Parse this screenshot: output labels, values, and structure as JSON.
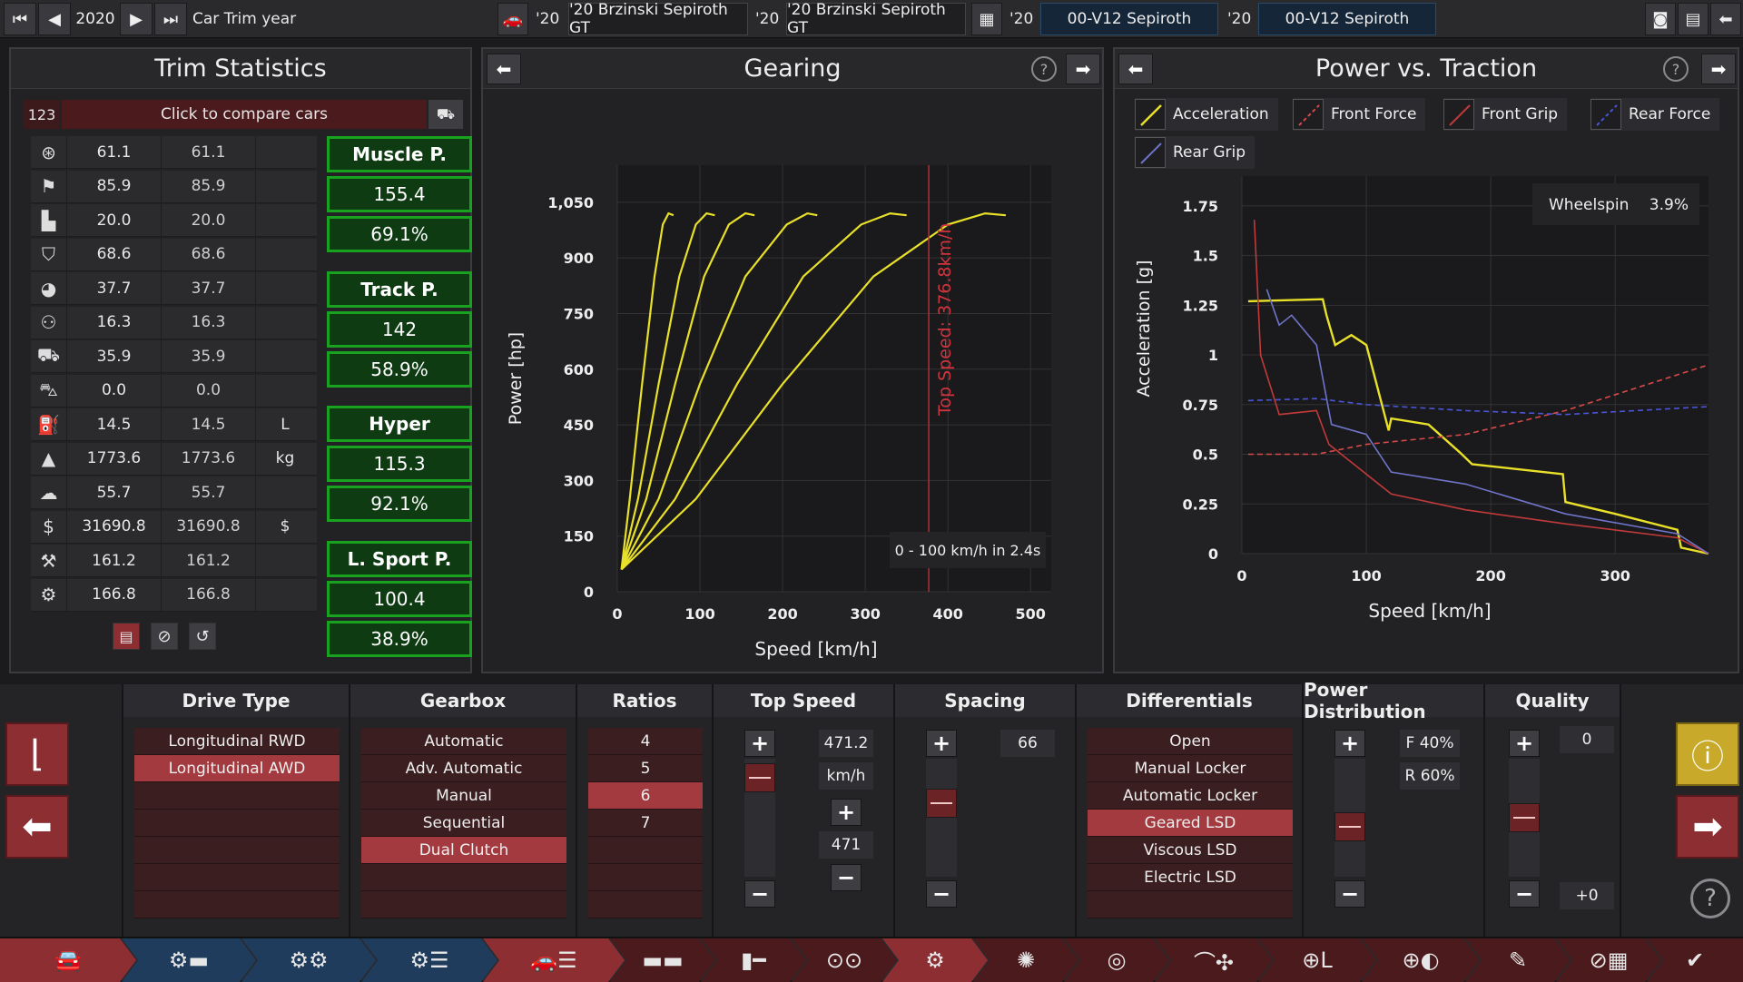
{
  "topbar": {
    "year": "2020",
    "year_label": "Car Trim year",
    "car_a_year": "'20",
    "car_a_name": "'20 Brzinski Sepiroth GT",
    "car_b_year": "'20",
    "car_b_name": "'20 Brzinski Sepiroth GT",
    "engine_a_year": "'20",
    "engine_a_name": "00-V12 Sepiroth",
    "engine_b_year": "'20",
    "engine_b_name": "00-V12 Sepiroth"
  },
  "trim": {
    "title": "Trim Statistics",
    "compare_id": "123",
    "compare_label": "Click to compare cars",
    "rows": [
      {
        "icon": "steering-wheel-icon",
        "v1": "61.1",
        "v2": "61.1",
        "unit": ""
      },
      {
        "icon": "race-flag-icon",
        "v1": "85.9",
        "v2": "85.9",
        "unit": ""
      },
      {
        "icon": "seat-icon",
        "v1": "20.0",
        "v2": "20.0",
        "unit": ""
      },
      {
        "icon": "shield-icon",
        "v1": "68.6",
        "v2": "68.6",
        "unit": ""
      },
      {
        "icon": "wheel-icon",
        "v1": "37.7",
        "v2": "37.7",
        "unit": ""
      },
      {
        "icon": "passengers-icon",
        "v1": "16.3",
        "v2": "16.3",
        "unit": ""
      },
      {
        "icon": "cargo-icon",
        "v1": "35.9",
        "v2": "35.9",
        "unit": ""
      },
      {
        "icon": "offroad-icon",
        "v1": "0.0",
        "v2": "0.0",
        "unit": ""
      },
      {
        "icon": "fuel-icon",
        "v1": "14.5",
        "v2": "14.5",
        "unit": "L"
      },
      {
        "icon": "weight-icon",
        "v1": "1773.6",
        "v2": "1773.6",
        "unit": "kg"
      },
      {
        "icon": "emissions-icon",
        "v1": "55.7",
        "v2": "55.7",
        "unit": ""
      },
      {
        "icon": "cost-icon",
        "v1": "31690.8",
        "v2": "31690.8",
        "unit": "$"
      },
      {
        "icon": "service-icon",
        "v1": "161.2",
        "v2": "161.2",
        "unit": ""
      },
      {
        "icon": "engineering-icon",
        "v1": "166.8",
        "v2": "166.8",
        "unit": ""
      }
    ],
    "demographics": [
      {
        "name": "Muscle P.",
        "value": "155.4",
        "pct": "69.1%"
      },
      {
        "name": "Track P.",
        "value": "142",
        "pct": "58.9%"
      },
      {
        "name": "Hyper",
        "value": "115.3",
        "pct": "92.1%"
      },
      {
        "name": "L. Sport P.",
        "value": "100.4",
        "pct": "38.9%"
      }
    ]
  },
  "gearing": {
    "title": "Gearing",
    "ylabel": "Power [hp]",
    "xlabel": "Speed [km/h]",
    "top_speed_label": "Top Speed: 376.8km/h",
    "accel_label": "0 - 100 km/h in 2.4s"
  },
  "traction": {
    "title": "Power vs. Traction",
    "ylabel": "Acceleration [g]",
    "xlabel": "Speed [km/h]",
    "wheelspin_label": "Wheelspin",
    "wheelspin_value": "3.9%",
    "legend": [
      "Acceleration",
      "Front Force",
      "Front Grip",
      "Rear Force",
      "Rear Grip"
    ]
  },
  "chart_data": [
    {
      "type": "line",
      "title": "Gearing",
      "xlabel": "Speed [km/h]",
      "ylabel": "Power [hp]",
      "xlim": [
        0,
        525
      ],
      "ylim": [
        0,
        1150
      ],
      "xticks": [
        0,
        100,
        200,
        300,
        400,
        500
      ],
      "yticks": [
        0,
        150,
        300,
        450,
        600,
        750,
        900,
        1050
      ],
      "annotations": [
        "Top Speed: 376.8km/h",
        "0 - 100 km/h in 2.4s"
      ],
      "top_speed": 376.8,
      "series": [
        {
          "x": [
            5,
            15,
            30,
            45,
            55,
            62,
            68
          ],
          "y": [
            60,
            250,
            560,
            850,
            990,
            1020,
            1015
          ]
        },
        {
          "x": [
            5,
            25,
            50,
            75,
            95,
            108,
            118
          ],
          "y": [
            60,
            250,
            560,
            850,
            990,
            1020,
            1015
          ]
        },
        {
          "x": [
            5,
            35,
            70,
            105,
            135,
            155,
            166
          ],
          "y": [
            60,
            250,
            560,
            850,
            990,
            1020,
            1015
          ]
        },
        {
          "x": [
            5,
            50,
            100,
            155,
            205,
            230,
            242
          ],
          "y": [
            60,
            250,
            560,
            850,
            990,
            1020,
            1015
          ]
        },
        {
          "x": [
            5,
            70,
            145,
            225,
            295,
            330,
            350
          ],
          "y": [
            60,
            250,
            560,
            850,
            990,
            1020,
            1015
          ]
        },
        {
          "x": [
            5,
            95,
            200,
            310,
            400,
            445,
            470
          ],
          "y": [
            60,
            250,
            560,
            850,
            990,
            1020,
            1015
          ]
        }
      ]
    },
    {
      "type": "line",
      "title": "Power vs. Traction",
      "xlabel": "Speed [km/h]",
      "ylabel": "Acceleration [g]",
      "xlim": [
        0,
        375
      ],
      "ylim": [
        0,
        1.9
      ],
      "xticks": [
        0,
        100,
        200,
        300
      ],
      "yticks": [
        0,
        0.25,
        0.5,
        0.75,
        1,
        1.25,
        1.5,
        1.75
      ],
      "series": [
        {
          "name": "Acceleration",
          "color": "#e9e02a",
          "x": [
            5,
            65,
            68,
            75,
            88,
            100,
            118,
            120,
            150,
            175,
            185,
            258,
            260,
            300,
            350,
            353,
            375
          ],
          "y": [
            1.27,
            1.28,
            1.2,
            1.05,
            1.1,
            1.05,
            0.62,
            0.68,
            0.65,
            0.51,
            0.45,
            0.4,
            0.26,
            0.2,
            0.12,
            0.03,
            0
          ]
        },
        {
          "name": "Front Force",
          "color": "#d84a4a",
          "x": [
            5,
            60,
            100,
            180,
            260,
            375
          ],
          "y": [
            0.5,
            0.5,
            0.55,
            0.6,
            0.72,
            0.95
          ]
        },
        {
          "name": "Front Grip",
          "color": "#c03a3a",
          "x": [
            10,
            15,
            30,
            60,
            70,
            120,
            180,
            260,
            350,
            375
          ],
          "y": [
            1.68,
            1.0,
            0.7,
            0.72,
            0.55,
            0.3,
            0.22,
            0.15,
            0.08,
            0
          ]
        },
        {
          "name": "Rear Force",
          "color": "#4a55d8",
          "x": [
            5,
            60,
            100,
            180,
            260,
            375
          ],
          "y": [
            0.77,
            0.78,
            0.75,
            0.72,
            0.7,
            0.74
          ]
        },
        {
          "name": "Rear Grip",
          "color": "#6f74c8",
          "x": [
            20,
            30,
            40,
            60,
            72,
            100,
            120,
            180,
            260,
            350,
            375
          ],
          "y": [
            1.33,
            1.15,
            1.2,
            1.05,
            0.65,
            0.6,
            0.41,
            0.35,
            0.2,
            0.1,
            0
          ]
        }
      ]
    }
  ],
  "bottom": {
    "drive_type": {
      "title": "Drive Type",
      "items": [
        "Longitudinal RWD",
        "Longitudinal AWD",
        "",
        "",
        "",
        "",
        ""
      ],
      "selected": 1
    },
    "gearbox": {
      "title": "Gearbox",
      "items": [
        "Automatic",
        "Adv. Automatic",
        "Manual",
        "Sequential",
        "Dual Clutch",
        "",
        ""
      ],
      "selected": 4
    },
    "ratios": {
      "title": "Ratios",
      "items": [
        "4",
        "5",
        "6",
        "7",
        "",
        "",
        ""
      ],
      "selected": 2
    },
    "top_speed": {
      "title": "Top Speed",
      "value": "471.2",
      "unit": "km/h",
      "target": "471",
      "level": 0.95
    },
    "spacing": {
      "title": "Spacing",
      "value": "66",
      "level": 0.66
    },
    "differentials": {
      "title": "Differentials",
      "items": [
        "Open",
        "Manual Locker",
        "Automatic Locker",
        "Geared LSD",
        "Viscous LSD",
        "Electric LSD",
        ""
      ],
      "selected": 3
    },
    "power_distribution": {
      "title": "Power Distribution",
      "front": "F 40%",
      "rear": "R 60%",
      "level": 0.4
    },
    "quality": {
      "title": "Quality",
      "value": "0",
      "delta": "+0",
      "level": 0.5
    }
  }
}
